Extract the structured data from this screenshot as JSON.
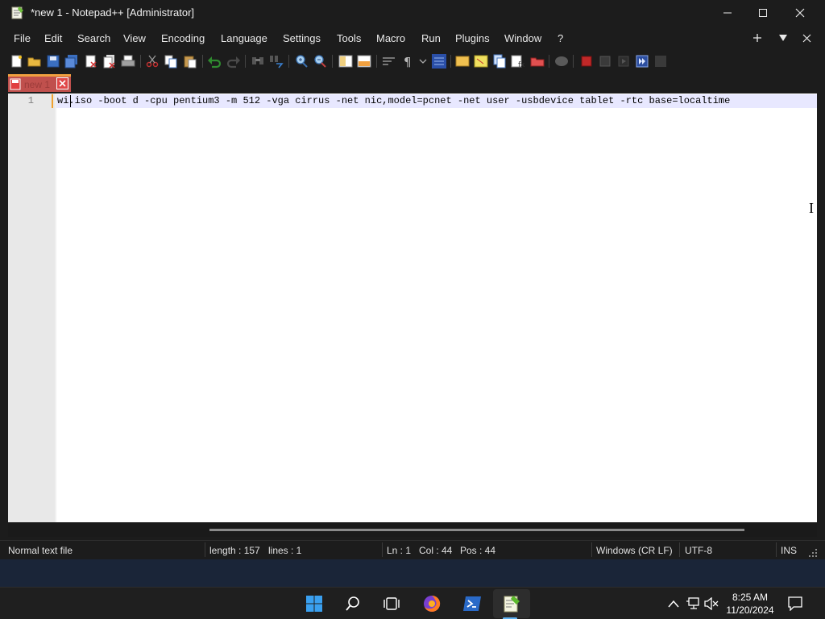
{
  "window": {
    "title": "*new 1 - Notepad++ [Administrator]"
  },
  "menu": {
    "items": [
      "File",
      "Edit",
      "Search",
      "View",
      "Encoding",
      "Language",
      "Settings",
      "Tools",
      "Macro",
      "Run",
      "Plugins",
      "Window",
      "?"
    ]
  },
  "tab": {
    "label": "new 1"
  },
  "editor": {
    "line_number": "1",
    "line_text": "wi.iso -boot d -cpu pentium3 -m 512 -vga cirrus -net nic,model=pcnet -net user -usbdevice tablet -rtc base=localtime"
  },
  "status": {
    "file_type": "Normal text file",
    "length": "length : 157",
    "lines": "lines : 1",
    "ln": "Ln : 1",
    "col": "Col : 44",
    "pos": "Pos : 44",
    "eol": "Windows (CR LF)",
    "encoding": "UTF-8",
    "mode": "INS"
  },
  "taskbar": {
    "time": "8:25 AM",
    "date": "11/20/2024"
  },
  "colors": {
    "accent": "#5fb2f2",
    "tab_active": "#c0504d",
    "current_line": "#e8e8ff"
  }
}
